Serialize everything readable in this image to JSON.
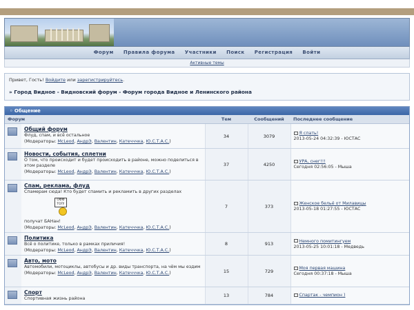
{
  "nav": {
    "items": [
      "Форум",
      "Правила форума",
      "Участники",
      "Поиск",
      "Регистрация",
      "Войти"
    ],
    "active_topics": "Активные темы"
  },
  "info": {
    "greeting_prefix": "Привет, Гость!",
    "login_link": "Войдите",
    "or_text": "или",
    "register_link": "зарегистрируйтесь",
    "breadcrumb": "» Город Видное - Видновский форум - Форум города Видное и Ленинского района"
  },
  "category": {
    "title": "Общение",
    "columns": {
      "forum": "Форум",
      "topics": "Тем",
      "posts": "Сообщений",
      "last": "Последнее сообщение"
    }
  },
  "moderators_label": "(Модераторы:",
  "moderators": [
    "McLeod",
    "АндрЭ",
    "Валентин",
    "Катечччка",
    "Ю.С.Т.А.С."
  ],
  "forums": [
    {
      "name": "Общий форум",
      "desc": "Флуд, спам, и всё остальное",
      "topics": "34",
      "posts": "3079",
      "last_title": "Я спать!",
      "last_meta": "2013-05-24 04:32:39 - ЮСТАС"
    },
    {
      "name": "Новости, события, сплетни",
      "desc": "О том, что происходит и будет происходить в районе, можно поделиться в этом разделе",
      "topics": "37",
      "posts": "4250",
      "last_title": "УРА, снег!!!",
      "last_meta": "Сегодня 02:56:05 - Мыша"
    },
    {
      "name": "Спам, реклама, флуд",
      "desc": "Спамерам сюда! Кто будет спамить и рекламить в других разделах",
      "desc2": "получат БАНан!",
      "sign_text": "ОФФ ТОП!",
      "topics": "7",
      "posts": "373",
      "last_title": "Женское бельё от Милавицы",
      "last_meta": "2013-05-18 01:27:55 - ЮСТАС"
    },
    {
      "name": "Политика",
      "desc": "Всё о политике, только в рамках приличия!",
      "topics": "8",
      "posts": "913",
      "last_title": "Немного помитингуем",
      "last_meta": "2013-05-25 10:01:18 - Медведь"
    },
    {
      "name": "Авто, мото",
      "desc": "Автомобили, мотоциклы, автобусы и др. виды транспорта, на чём мы ездим",
      "topics": "15",
      "posts": "729",
      "last_title": "Моя первая машина",
      "last_meta": "Сегодня 00:37:18 - Мыша"
    },
    {
      "name": "Спорт",
      "desc": "Спортивная жизнь района",
      "topics": "13",
      "posts": "784",
      "last_title": "Спартак - чемпион )",
      "last_meta": ""
    }
  ]
}
